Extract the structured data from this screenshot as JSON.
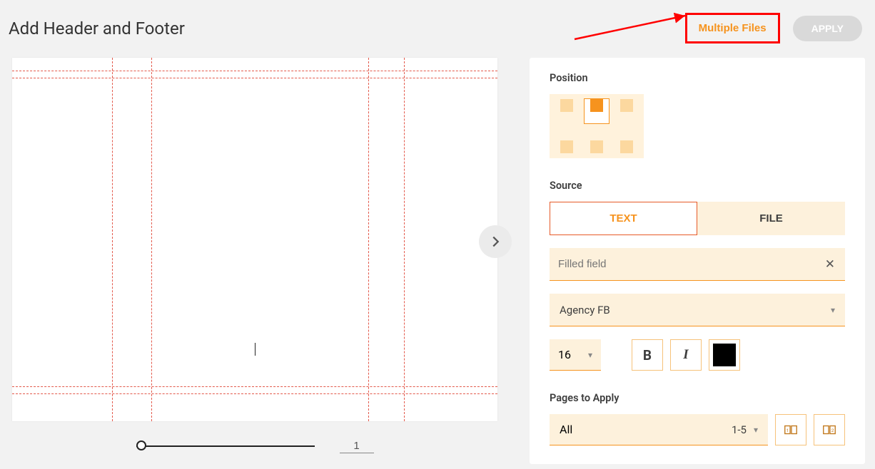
{
  "header": {
    "title": "Add Header and Footer",
    "multiple_files": "Multiple Files",
    "apply": "APPLY"
  },
  "preview": {
    "page_number": "1"
  },
  "panel": {
    "position_label": "Position",
    "source_label": "Source",
    "source_tabs": {
      "text": "TEXT",
      "file": "FILE"
    },
    "text_placeholder": "Filled field",
    "font_family": "Agency FB",
    "font_size": "16",
    "bold_label": "B",
    "italic_label": "I",
    "color": "#000000",
    "pages_label": "Pages to Apply",
    "pages_mode": "All",
    "pages_range": "1-5"
  }
}
